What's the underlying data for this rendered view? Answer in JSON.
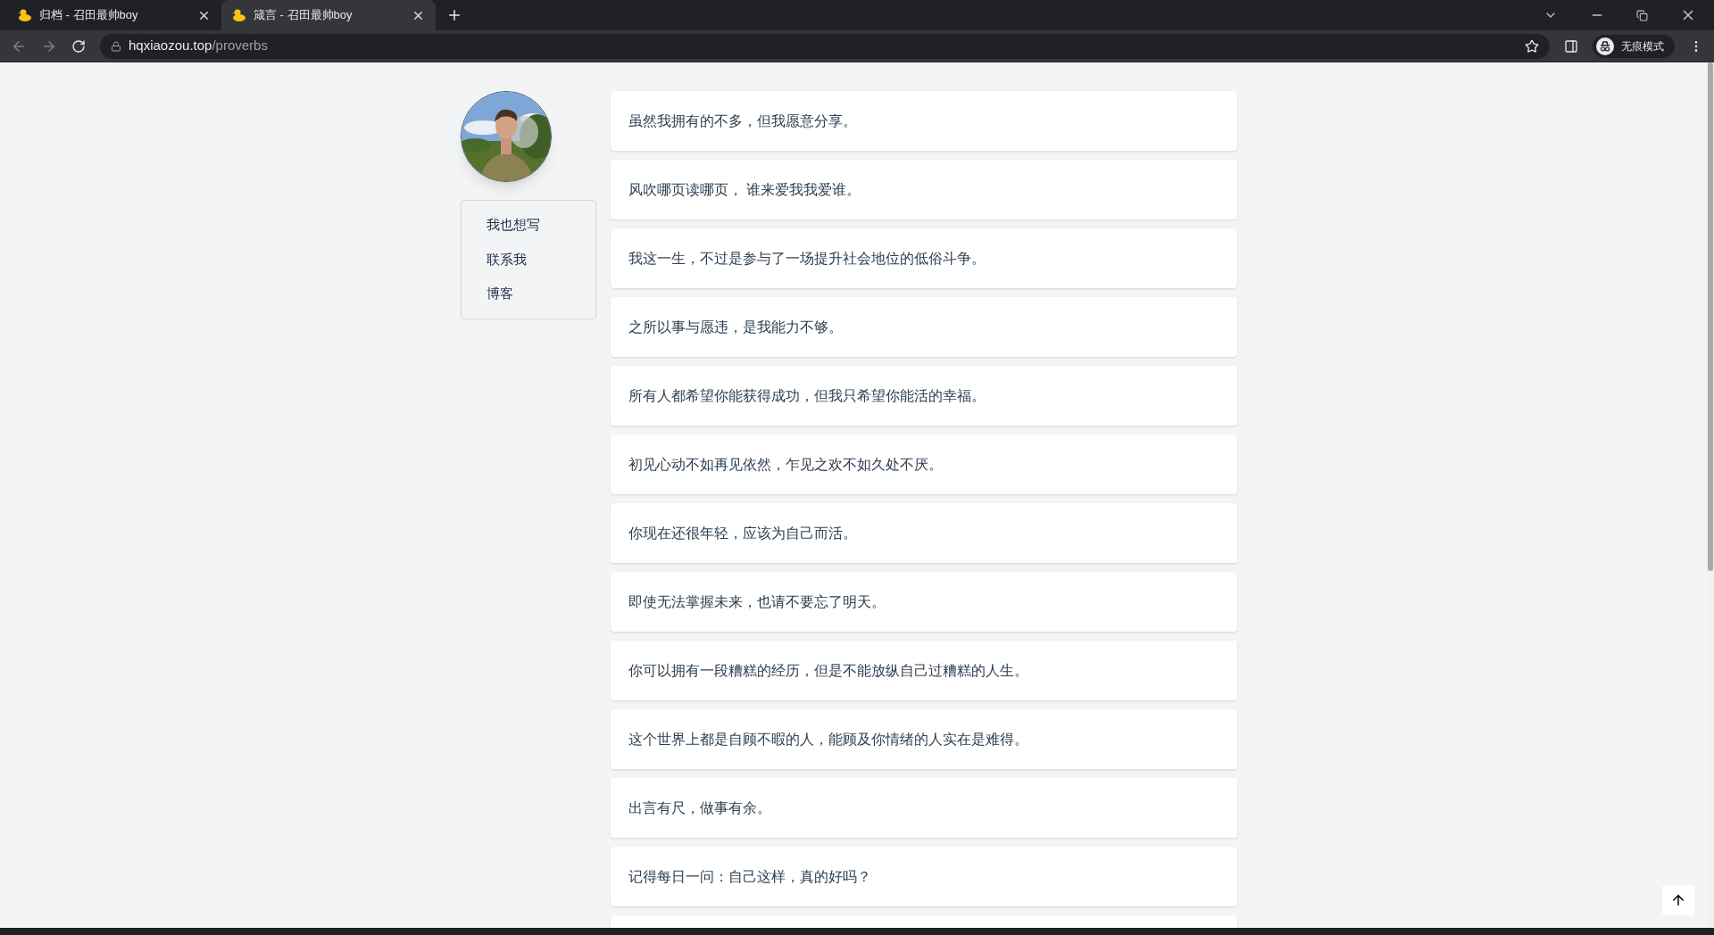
{
  "browser": {
    "tabs": [
      {
        "title": "归档 - 召田最帅boy",
        "selected": false
      },
      {
        "title": "箴言 - 召田最帅boy",
        "selected": true
      }
    ],
    "address": {
      "host": "hqxiaozou.top",
      "path": "/proverbs"
    },
    "profile": "无痕模式"
  },
  "menu": [
    {
      "label": "我也想写"
    },
    {
      "label": "联系我"
    },
    {
      "label": "博客"
    }
  ],
  "proverbs": [
    "虽然我拥有的不多，但我愿意分享。",
    "风吹哪页读哪页， 谁来爱我我爱谁。",
    "我这一生，不过是参与了一场提升社会地位的低俗斗争。",
    "之所以事与愿违，是我能力不够。",
    "所有人都希望你能获得成功，但我只希望你能活的幸福。",
    "初见心动不如再见依然，乍见之欢不如久处不厌。",
    "你现在还很年轻，应该为自己而活。",
    "即使无法掌握未来，也请不要忘了明天。",
    "你可以拥有一段糟糕的经历，但是不能放纵自己过糟糕的人生。",
    "这个世界上都是自顾不暇的人，能顾及你情绪的人实在是难得。",
    "出言有尺，做事有余。",
    "记得每日一问：自己这样，真的好吗？"
  ]
}
